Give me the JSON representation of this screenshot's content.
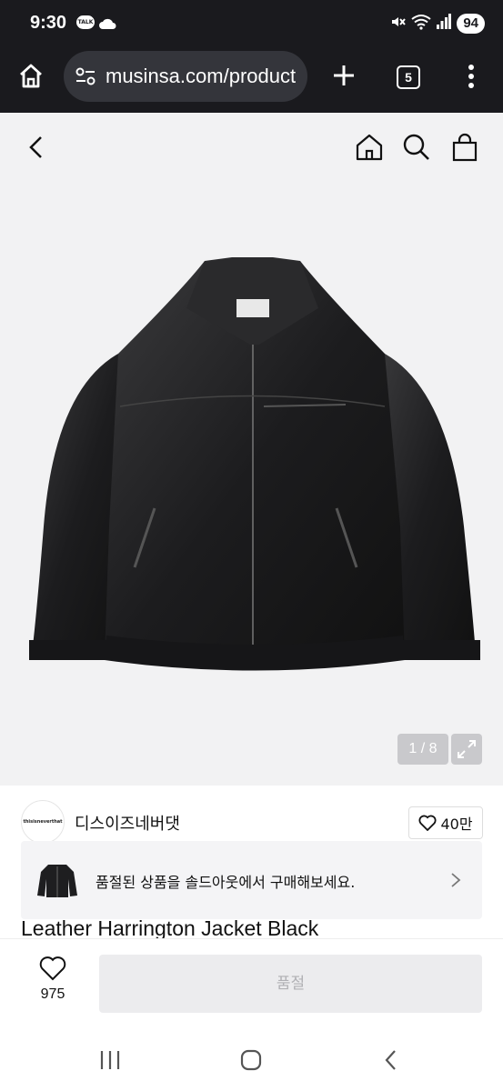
{
  "status_bar": {
    "time": "9:30",
    "talk_badge": "TALK",
    "battery": "94",
    "icons": [
      "kakaotalk-icon",
      "cloud-icon",
      "mute-icon",
      "wifi-icon",
      "signal-icon",
      "battery-icon"
    ]
  },
  "browser": {
    "url": "musinsa.com/product",
    "tab_count": "5",
    "icons": [
      "home-icon",
      "site-settings-icon",
      "plus-icon",
      "tabs-icon",
      "more-icon"
    ]
  },
  "product_nav": {
    "icons": [
      "back-icon",
      "home-icon",
      "search-icon",
      "shopping-bag-icon"
    ]
  },
  "gallery": {
    "counter": "1 / 8",
    "icons": [
      "expand-icon"
    ]
  },
  "brand": {
    "logo_text": "thisisneverthat",
    "name": "디스이즈네버댓",
    "likes": "40만"
  },
  "soldout_banner": {
    "message": "품절된 상품을 솔드아웃에서 구매해보세요."
  },
  "product": {
    "title": "Leather Harrington Jacket Black"
  },
  "action_bar": {
    "wish_count": "975",
    "buy_label": "품절"
  },
  "colors": {
    "system_bar": "#1a1a1e",
    "url_box": "#34353b",
    "image_bg": "#f2f2f3",
    "disabled_button": "#ececee"
  }
}
